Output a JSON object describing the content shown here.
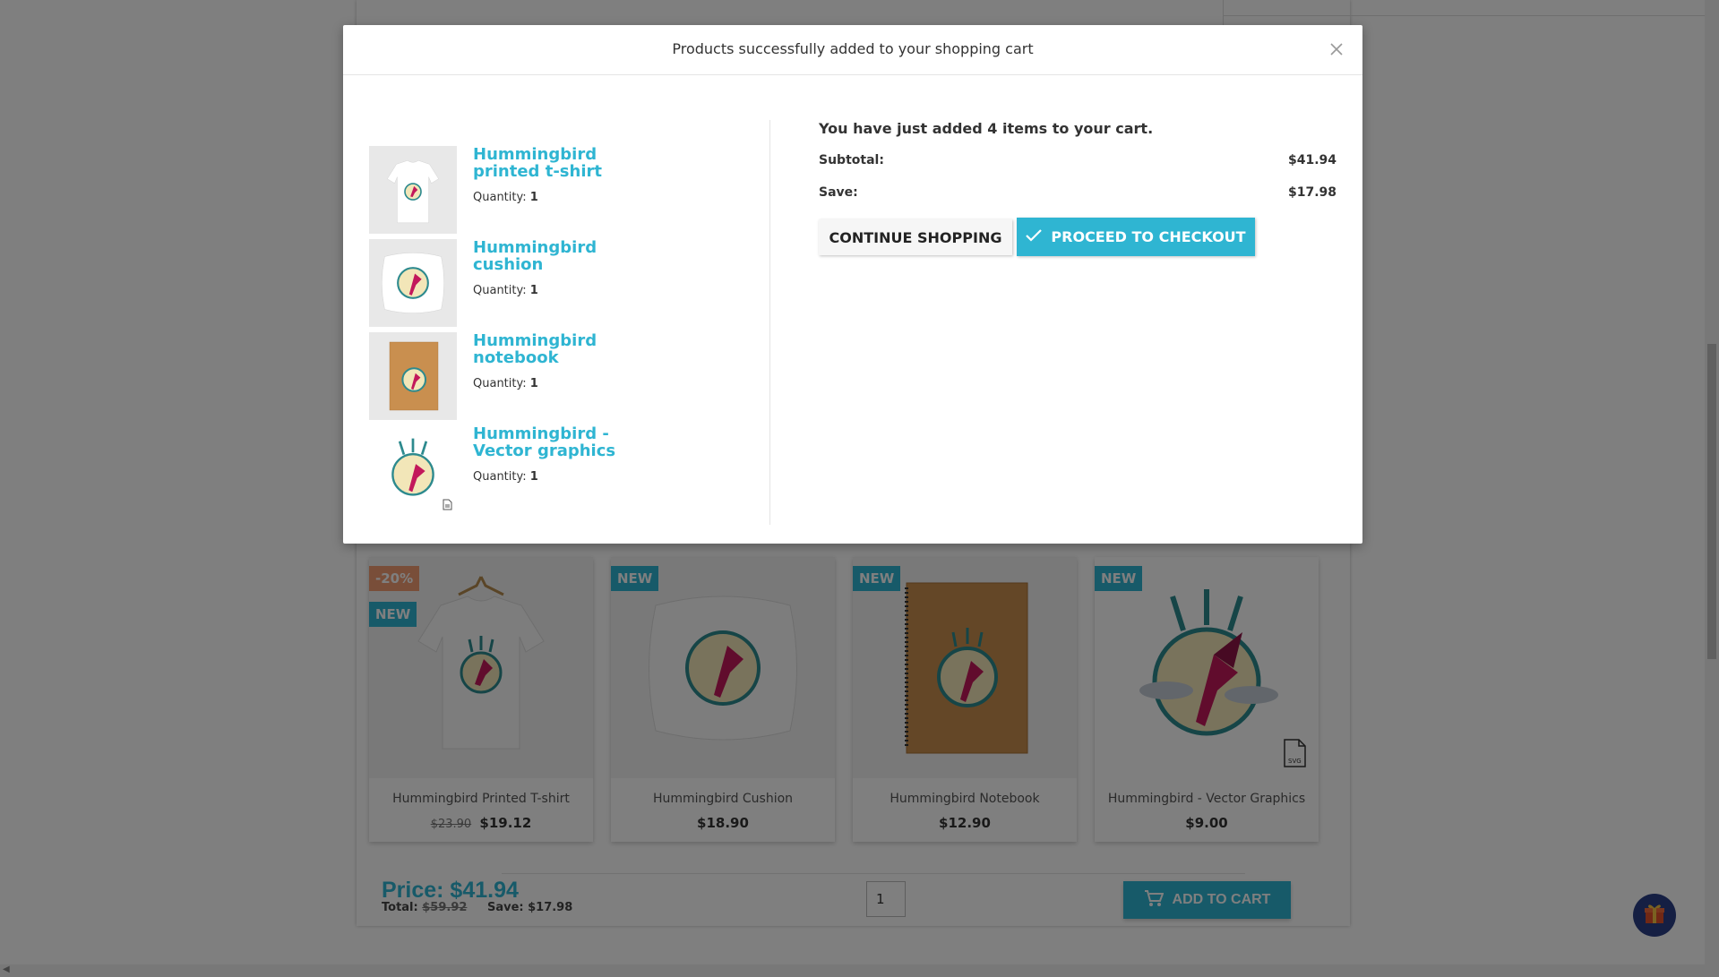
{
  "modal": {
    "title": "Products successfully added to your shopping cart",
    "close_icon": "close-icon",
    "items": [
      {
        "name": "Hummingbird printed t-shirt",
        "quantity_label": "Quantity:",
        "quantity": "1",
        "thumb": "tshirt"
      },
      {
        "name": "Hummingbird cushion",
        "quantity_label": "Quantity:",
        "quantity": "1",
        "thumb": "cushion"
      },
      {
        "name": "Hummingbird notebook",
        "quantity_label": "Quantity:",
        "quantity": "1",
        "thumb": "notebook"
      },
      {
        "name": "Hummingbird - Vector graphics",
        "quantity_label": "Quantity:",
        "quantity": "1",
        "thumb": "vector"
      }
    ],
    "summary": {
      "added_message": "You have just added 4 items to your cart.",
      "subtotal_label": "Subtotal:",
      "subtotal_value": "$41.94",
      "save_label": "Save:",
      "save_value": "$17.98"
    },
    "continue_label": "CONTINUE SHOPPING",
    "checkout_label": "PROCEED TO CHECKOUT"
  },
  "products": [
    {
      "name": "Hummingbird Printed T-shirt",
      "old_price": "$23.90",
      "price": "$19.12",
      "badges": [
        "-20%",
        "NEW"
      ]
    },
    {
      "name": "Hummingbird Cushion",
      "old_price": "",
      "price": "$18.90",
      "badges": [
        "NEW"
      ]
    },
    {
      "name": "Hummingbird Notebook",
      "old_price": "",
      "price": "$12.90",
      "badges": [
        "NEW"
      ]
    },
    {
      "name": "Hummingbird - Vector Graphics",
      "old_price": "",
      "price": "$9.00",
      "badges": [
        "NEW"
      ]
    }
  ],
  "bundle": {
    "price_label": "Price: $41.94",
    "total_label": "Total:",
    "total_value": "$59.92",
    "save_label": "Save: $17.98",
    "quantity_value": "1",
    "add_to_cart_label": "ADD TO CART"
  },
  "colors": {
    "accent": "#2fb5d2",
    "discount": "#f39d72",
    "gift_button": "#2a3f86"
  }
}
